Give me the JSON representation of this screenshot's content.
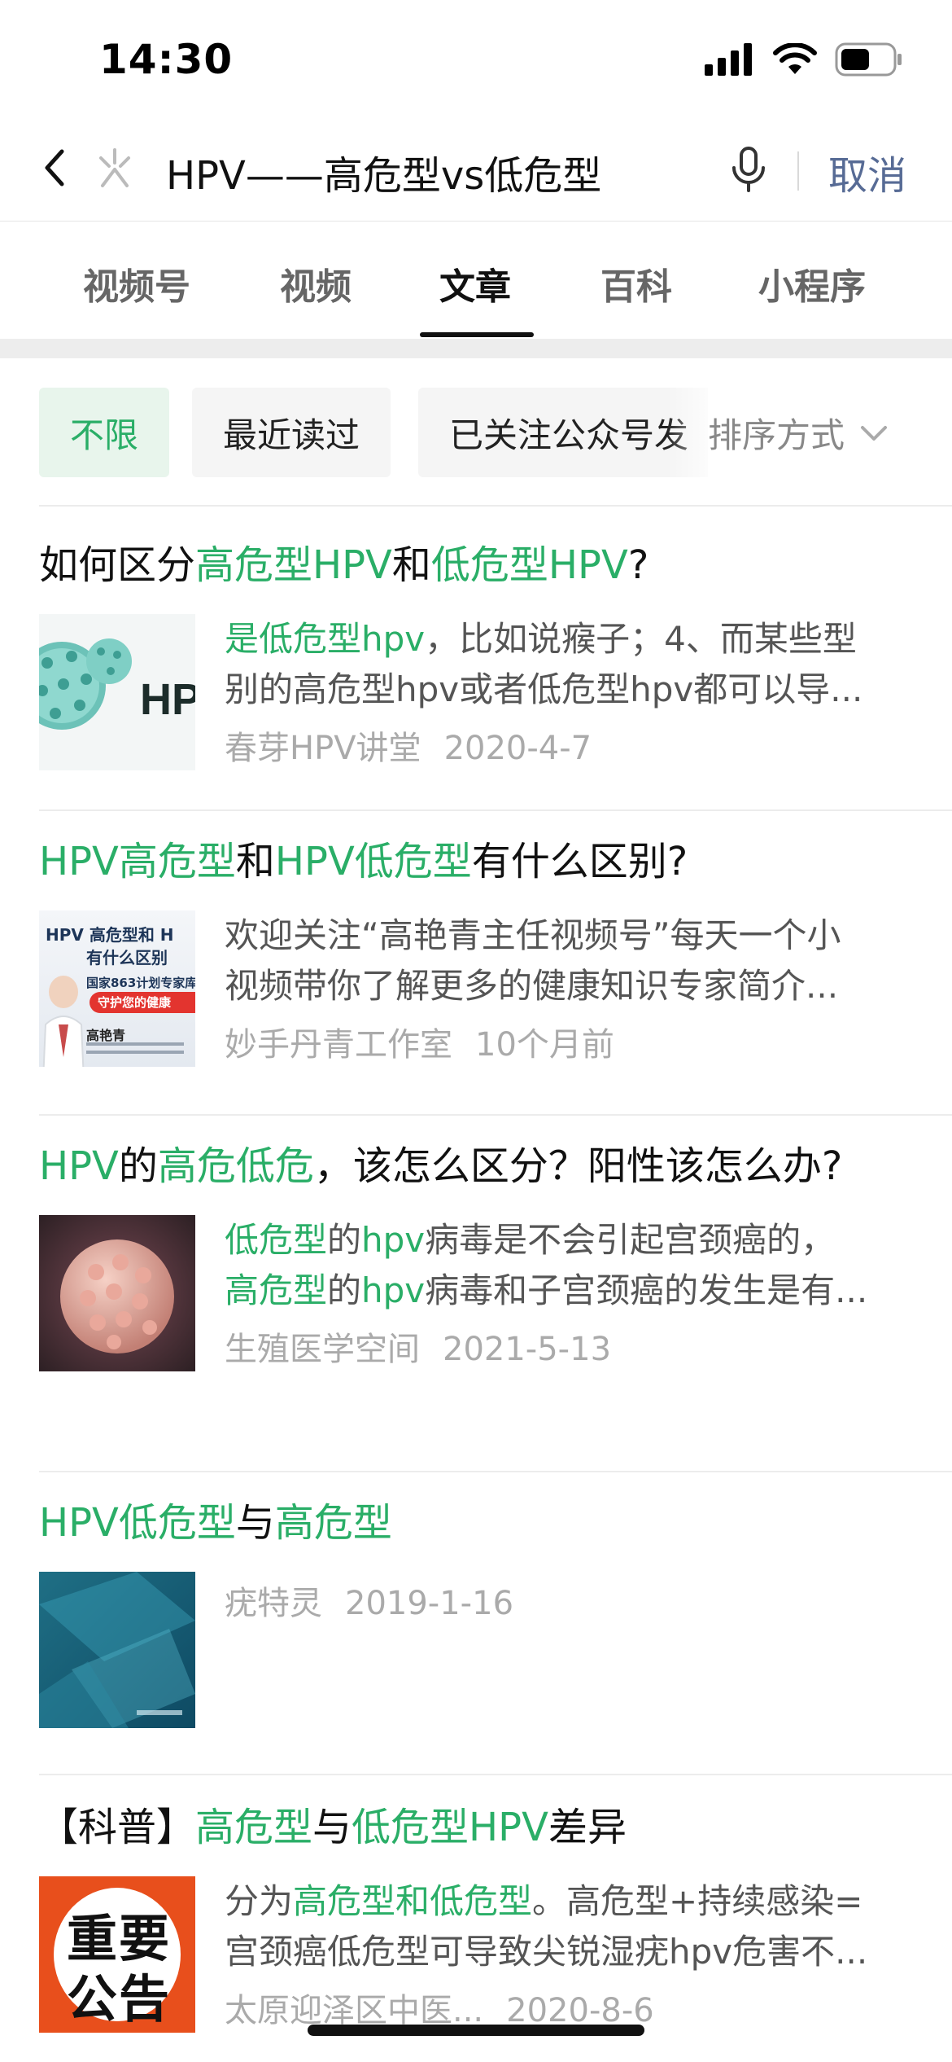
{
  "status": {
    "time": "14:30"
  },
  "search": {
    "query": "HPV——高危型vs低危型",
    "cancel": "取消"
  },
  "tabs": [
    {
      "label": "视频号",
      "active": false
    },
    {
      "label": "视频",
      "active": false
    },
    {
      "label": "文章",
      "active": true
    },
    {
      "label": "百科",
      "active": false
    },
    {
      "label": "小程序",
      "active": false
    }
  ],
  "filters": {
    "chips": [
      "不限",
      "最近读过",
      "已关注公众号发"
    ],
    "sort": "排序方式"
  },
  "results": [
    {
      "title": [
        [
          "如何区分",
          false
        ],
        [
          "高危型HPV",
          true
        ],
        [
          "和",
          false
        ],
        [
          "低危型HPV",
          true
        ],
        [
          "?",
          false
        ]
      ],
      "snippet": [
        [
          "是低危型hpv",
          true
        ],
        [
          "，比如说瘊子；4、而某些型",
          false
        ]
      ],
      "snippet2": "别的高危型hpv或者低危型hpv都可以导...",
      "source": "春芽HPV讲堂",
      "date": "2020-4-7",
      "thumb": "hpv-virus-teal",
      "thumb_text": "HP"
    },
    {
      "title": [
        [
          "HPV高危型",
          true
        ],
        [
          "和",
          false
        ],
        [
          "HPV低危型",
          true
        ],
        [
          "有什么区别?",
          false
        ]
      ],
      "snippet": [
        [
          "欢迎关注“高艳青主任视频号”每天一个小",
          false
        ]
      ],
      "snippet2": "视频带你了解更多的健康知识专家简介...",
      "source": "妙手丹青工作室",
      "date": "10个月前",
      "thumb": "doctor-poster",
      "thumb_text": "HPV 高危型和 H",
      "thumb_text2": "有什么区别",
      "thumb_text3": "国家863计划专家库",
      "thumb_text4": "守护您的健康",
      "thumb_text5": "高艳青"
    },
    {
      "title": [
        [
          "HPV",
          true
        ],
        [
          "的",
          false
        ],
        [
          "高危低危",
          true
        ],
        [
          "，该怎么区分？阳性该怎么办?",
          false
        ]
      ],
      "snippet": [
        [
          "低危型",
          true
        ],
        [
          "的",
          false
        ],
        [
          "hpv",
          true
        ],
        [
          "病毒是不会引起宫颈癌的，",
          false
        ]
      ],
      "snippet2_parts": [
        [
          "高危型",
          true
        ],
        [
          "的",
          false
        ],
        [
          "hpv",
          true
        ],
        [
          "病毒和子宫颈癌的发生是有...",
          false
        ]
      ],
      "source": "生殖医学空间",
      "date": "2021-5-13",
      "thumb": "virus-pink"
    },
    {
      "title": [
        [
          "HPV低危型",
          true
        ],
        [
          "与",
          false
        ],
        [
          "高危型",
          true
        ]
      ],
      "snippet": [],
      "source": "疣特灵",
      "date": "2019-1-16",
      "thumb": "blue-abstract"
    },
    {
      "title": [
        [
          "【科普】",
          false
        ],
        [
          "高危型",
          true
        ],
        [
          "与",
          false
        ],
        [
          "低危型HPV",
          true
        ],
        [
          "差异",
          false
        ]
      ],
      "snippet": [
        [
          "分为",
          false
        ],
        [
          "高危型和低危型",
          true
        ],
        [
          "。高危型+持续感染=",
          false
        ]
      ],
      "snippet2": "宫颈癌低危型可导致尖锐湿疣hpv危害不...",
      "source": "太原迎泽区中医...",
      "date": "2020-8-6",
      "thumb": "notice-poster",
      "thumb_text": "重要",
      "thumb_text2": "公告"
    }
  ],
  "colors": {
    "highlight": "#2aae67",
    "cancel": "#576b95",
    "chip_active_bg": "#e8f5ec"
  }
}
